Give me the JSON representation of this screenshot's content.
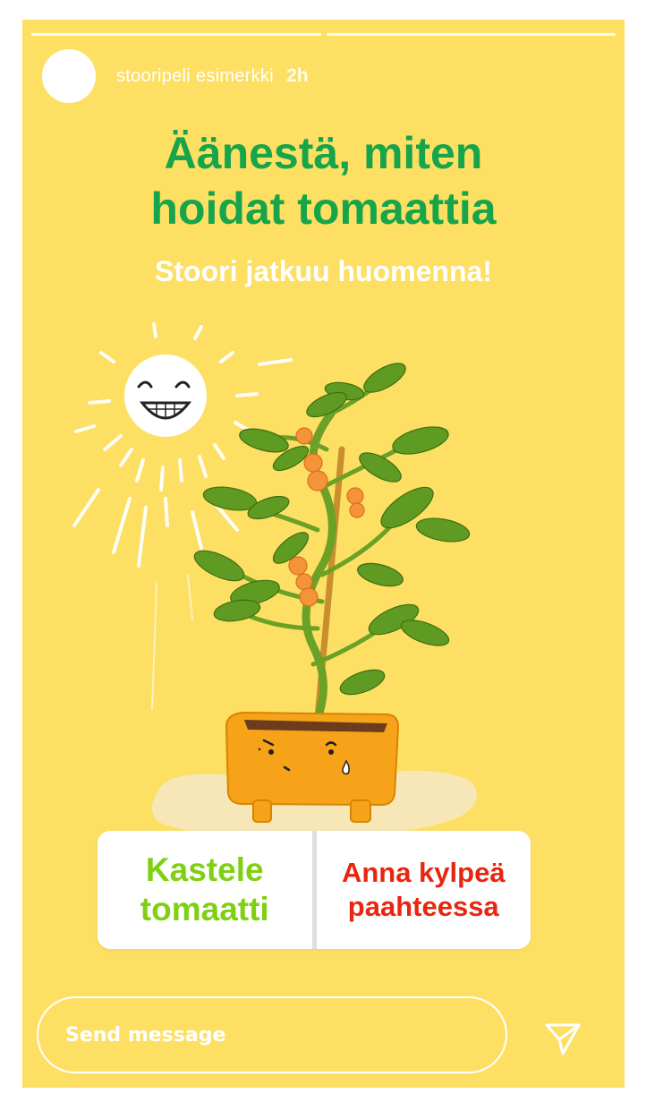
{
  "story": {
    "username": "stooripeli esimerkki",
    "time": "2h",
    "segments": 2
  },
  "content": {
    "title_line1": "Äänestä, miten",
    "title_line2": "hoidat tomaattia",
    "subtitle": "Stoori jatkuu huomenna!"
  },
  "poll": {
    "option_a_line1": "Kastele",
    "option_a_line2": "tomaatti",
    "option_b_line1": "Anna kylpeä",
    "option_b_line2": "paahteessa"
  },
  "composer": {
    "placeholder": "Send message"
  },
  "colors": {
    "background": "#fddf63",
    "title": "#16a54a",
    "option_a": "#7fd012",
    "option_b": "#e8260f"
  },
  "icons": {
    "send": "paper-plane-icon",
    "sun": "smiling-sun-icon",
    "plant": "tomato-plant-illustration"
  }
}
